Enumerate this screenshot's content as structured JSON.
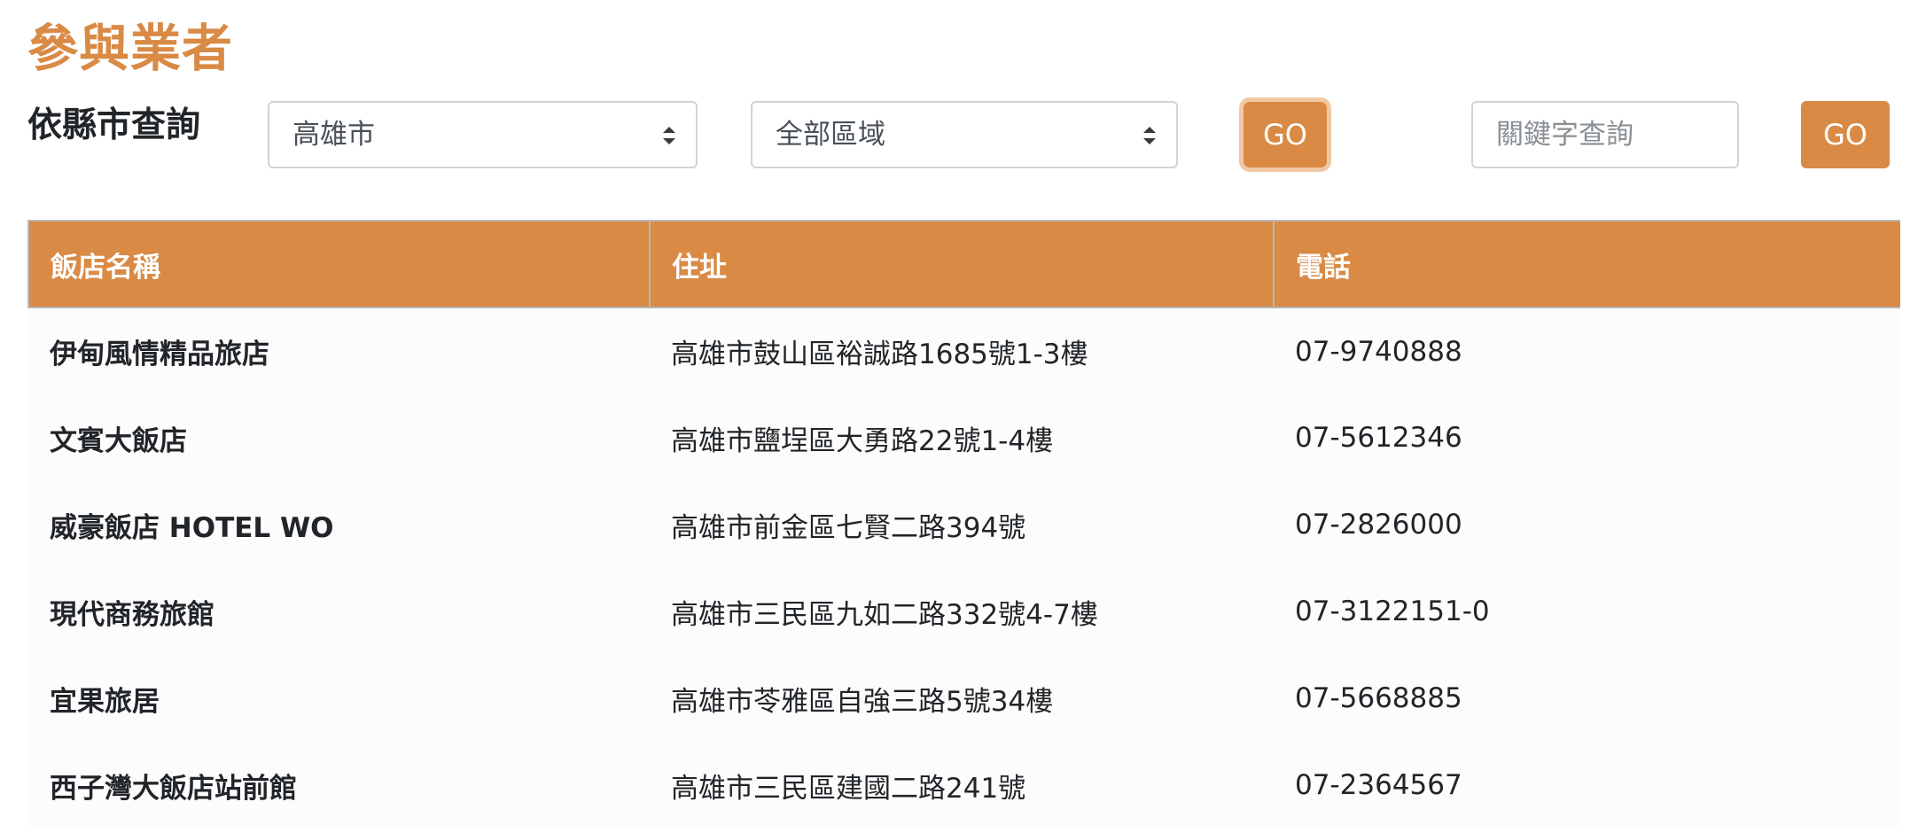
{
  "header": {
    "title": "參與業者",
    "filter_label": "依縣市查詢"
  },
  "filters": {
    "city_value": "高雄市",
    "area_value": "全部區域",
    "go_label": "GO",
    "keyword_placeholder": "關鍵字查詢",
    "keyword_go_label": "GO"
  },
  "colors": {
    "accent": "#d98a45",
    "accent_focus_ring": "#f0c8a4"
  },
  "table": {
    "headers": [
      "飯店名稱",
      "住址",
      "電話"
    ],
    "rows": [
      {
        "name": "伊甸風情精品旅店",
        "address": "高雄市鼓山區裕誠路1685號1-3樓",
        "phone": "07-9740888"
      },
      {
        "name": "文賓大飯店",
        "address": "高雄市鹽埕區大勇路22號1-4樓",
        "phone": "07-5612346"
      },
      {
        "name": "威豪飯店 HOTEL WO",
        "address": "高雄市前金區七賢二路394號",
        "phone": "07-2826000"
      },
      {
        "name": "現代商務旅館",
        "address": "高雄市三民區九如二路332號4-7樓",
        "phone": "07-3122151-0"
      },
      {
        "name": "宜果旅居",
        "address": "高雄市苓雅區自強三路5號34樓",
        "phone": "07-5668885"
      },
      {
        "name": "西子灣大飯店站前館",
        "address": "高雄市三民區建國二路241號",
        "phone": "07-2364567"
      }
    ]
  }
}
